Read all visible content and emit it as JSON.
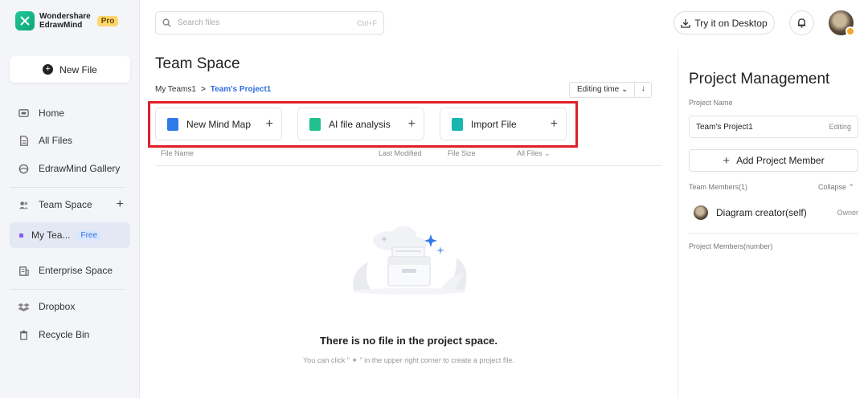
{
  "app": {
    "brand_line1": "Wondershare",
    "brand_line2": "EdrawMind",
    "tier_badge": "Pro"
  },
  "sidebar": {
    "new_file_label": "New File",
    "items": [
      {
        "label": "Home",
        "icon": "home-icon"
      },
      {
        "label": "All Files",
        "icon": "file-icon"
      },
      {
        "label": "EdrawMind Gallery",
        "icon": "gallery-icon"
      },
      {
        "label": "Team Space",
        "icon": "team-icon"
      },
      {
        "label": "My Tea...",
        "badge": "Free"
      },
      {
        "label": "Enterprise Space",
        "icon": "building-icon"
      },
      {
        "label": "Dropbox",
        "icon": "dropbox-icon"
      },
      {
        "label": "Recycle Bin",
        "icon": "trash-icon"
      }
    ]
  },
  "topbar": {
    "search_placeholder": "Search files",
    "search_shortcut": "Ctrl+F",
    "desktop_label": "Try it on Desktop"
  },
  "main": {
    "title": "Team Space",
    "breadcrumb": [
      "My Teams1",
      "Team's Project1"
    ],
    "sort_label": "Editing time",
    "actions": [
      {
        "label": "New Mind Map",
        "color": "#2f7bea"
      },
      {
        "label": "AI file analysis",
        "color": "#20c08f"
      },
      {
        "label": "Import File",
        "color": "#17b7b0"
      }
    ],
    "columns": {
      "name": "File Name",
      "modified": "Last Modified",
      "size": "File Size",
      "filter": "All Files"
    },
    "empty_title": "There is no file in the project space.",
    "empty_sub": "You can click \" ✦ \" in the upper right corner to create a project file."
  },
  "panel": {
    "title": "Project Management",
    "name_label": "Project Name",
    "name_value": "Team's Project1",
    "name_status": "Editing",
    "add_member_label": "Add Project Member",
    "team_members_label": "Team Members(1)",
    "collapse_label": "Collapse",
    "member_name": "Diagram creator(self)",
    "member_role": "Owner",
    "project_members_label": "Project Members(number)"
  },
  "colors": {
    "highlight_border": "#e01f28",
    "link_blue": "#2f6fdd",
    "active_bg": "#e4e8f4"
  }
}
